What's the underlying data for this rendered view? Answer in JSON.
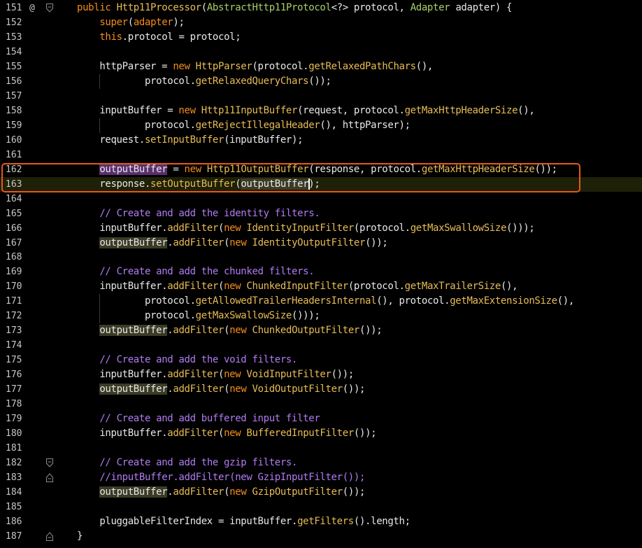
{
  "editor": {
    "colors": {
      "background": "#000000",
      "keyword": "#f48c1b",
      "method": "#e8bc55",
      "plain": "#e8e8e8",
      "comment": "#b07cf2",
      "type": "#a8cf6a",
      "selection_box": "#e8571b"
    },
    "lines": [
      {
        "n": "151",
        "gutter": "@",
        "fold": "fold-open",
        "tokens": [
          [
            "kw",
            "public "
          ],
          [
            "fn",
            "Http11Processor"
          ],
          [
            "pl",
            "("
          ],
          [
            "ty",
            "AbstractHttp11Protocol"
          ],
          [
            "pl",
            "<?> protocol, "
          ],
          [
            "ty",
            "Adapter"
          ],
          [
            "pl",
            " adapter) {"
          ]
        ]
      },
      {
        "n": "152",
        "tokens": [
          [
            "pl",
            "    "
          ],
          [
            "kw",
            "super"
          ],
          [
            "pl",
            "("
          ],
          [
            "kw",
            "adapter"
          ],
          [
            "pl",
            ");"
          ]
        ]
      },
      {
        "n": "153",
        "tokens": [
          [
            "pl",
            "    "
          ],
          [
            "kw",
            "this"
          ],
          [
            "pl",
            ".protocol = protocol;"
          ]
        ]
      },
      {
        "n": "154",
        "tokens": []
      },
      {
        "n": "155",
        "tokens": [
          [
            "pl",
            "    httpParser = "
          ],
          [
            "kw",
            "new "
          ],
          [
            "fn",
            "HttpParser"
          ],
          [
            "pl",
            "(protocol."
          ],
          [
            "fn",
            "getRelaxedPathChars"
          ],
          [
            "pl",
            "(),"
          ]
        ]
      },
      {
        "n": "156",
        "guide": true,
        "tokens": [
          [
            "pl",
            "            protocol."
          ],
          [
            "fn",
            "getRelaxedQueryChars"
          ],
          [
            "pl",
            "());"
          ]
        ]
      },
      {
        "n": "157",
        "tokens": []
      },
      {
        "n": "158",
        "tokens": [
          [
            "pl",
            "    inputBuffer = "
          ],
          [
            "kw",
            "new "
          ],
          [
            "fn",
            "Http11InputBuffer"
          ],
          [
            "pl",
            "(request, protocol."
          ],
          [
            "fn",
            "getMaxHttpHeaderSize"
          ],
          [
            "pl",
            "(),"
          ]
        ]
      },
      {
        "n": "159",
        "guide": true,
        "tokens": [
          [
            "pl",
            "            protocol."
          ],
          [
            "fn",
            "getRejectIllegalHeader"
          ],
          [
            "pl",
            "(), httpParser);"
          ]
        ]
      },
      {
        "n": "160",
        "tokens": [
          [
            "pl",
            "    request."
          ],
          [
            "fn",
            "setInputBuffer"
          ],
          [
            "pl",
            "(inputBuffer);"
          ]
        ]
      },
      {
        "n": "161",
        "tokens": []
      },
      {
        "n": "162",
        "tokens": [
          [
            "pl",
            "    "
          ],
          [
            "write",
            "outputBuffer"
          ],
          [
            "pl",
            " = "
          ],
          [
            "kw",
            "new "
          ],
          [
            "fn",
            "Http11OutputBuffer"
          ],
          [
            "pl",
            "(response, protocol."
          ],
          [
            "fn",
            "getMaxHttpHeaderSize"
          ],
          [
            "pl",
            "());"
          ]
        ]
      },
      {
        "n": "163",
        "cursorline": true,
        "tokens": [
          [
            "pl",
            "    response."
          ],
          [
            "fn",
            "setOutputBuffer"
          ],
          [
            "pl",
            "("
          ],
          [
            "readcaret",
            "outputBuffer"
          ],
          [
            "pl",
            ");"
          ]
        ]
      },
      {
        "n": "164",
        "tokens": []
      },
      {
        "n": "165",
        "tokens": [
          [
            "pl",
            "    "
          ],
          [
            "cm",
            "// Create and add the identity filters."
          ]
        ]
      },
      {
        "n": "166",
        "tokens": [
          [
            "pl",
            "    inputBuffer."
          ],
          [
            "fn",
            "addFilter"
          ],
          [
            "pl",
            "("
          ],
          [
            "kw",
            "new "
          ],
          [
            "fn",
            "IdentityInputFilter"
          ],
          [
            "pl",
            "(protocol."
          ],
          [
            "fn",
            "getMaxSwallowSize"
          ],
          [
            "pl",
            "()));"
          ]
        ]
      },
      {
        "n": "167",
        "tokens": [
          [
            "pl",
            "    "
          ],
          [
            "read",
            "outputBuffer"
          ],
          [
            "pl",
            "."
          ],
          [
            "fn",
            "addFilter"
          ],
          [
            "pl",
            "("
          ],
          [
            "kw",
            "new "
          ],
          [
            "fn",
            "IdentityOutputFilter"
          ],
          [
            "pl",
            "());"
          ]
        ]
      },
      {
        "n": "168",
        "tokens": []
      },
      {
        "n": "169",
        "tokens": [
          [
            "pl",
            "    "
          ],
          [
            "cm",
            "// Create and add the chunked filters."
          ]
        ]
      },
      {
        "n": "170",
        "tokens": [
          [
            "pl",
            "    inputBuffer."
          ],
          [
            "fn",
            "addFilter"
          ],
          [
            "pl",
            "("
          ],
          [
            "kw",
            "new "
          ],
          [
            "fn",
            "ChunkedInputFilter"
          ],
          [
            "pl",
            "(protocol."
          ],
          [
            "fn",
            "getMaxTrailerSize"
          ],
          [
            "pl",
            "(),"
          ]
        ]
      },
      {
        "n": "171",
        "guide": true,
        "tokens": [
          [
            "pl",
            "            protocol."
          ],
          [
            "fn",
            "getAllowedTrailerHeadersInternal"
          ],
          [
            "pl",
            "(), protocol."
          ],
          [
            "fn",
            "getMaxExtensionSize"
          ],
          [
            "pl",
            "(),"
          ]
        ]
      },
      {
        "n": "172",
        "guide": true,
        "tokens": [
          [
            "pl",
            "            protocol."
          ],
          [
            "fn",
            "getMaxSwallowSize"
          ],
          [
            "pl",
            "()));"
          ]
        ]
      },
      {
        "n": "173",
        "tokens": [
          [
            "pl",
            "    "
          ],
          [
            "read",
            "outputBuffer"
          ],
          [
            "pl",
            "."
          ],
          [
            "fn",
            "addFilter"
          ],
          [
            "pl",
            "("
          ],
          [
            "kw",
            "new "
          ],
          [
            "fn",
            "ChunkedOutputFilter"
          ],
          [
            "pl",
            "());"
          ]
        ]
      },
      {
        "n": "174",
        "tokens": []
      },
      {
        "n": "175",
        "tokens": [
          [
            "pl",
            "    "
          ],
          [
            "cm",
            "// Create and add the void filters."
          ]
        ]
      },
      {
        "n": "176",
        "tokens": [
          [
            "pl",
            "    inputBuffer."
          ],
          [
            "fn",
            "addFilter"
          ],
          [
            "pl",
            "("
          ],
          [
            "kw",
            "new "
          ],
          [
            "fn",
            "VoidInputFilter"
          ],
          [
            "pl",
            "());"
          ]
        ]
      },
      {
        "n": "177",
        "tokens": [
          [
            "pl",
            "    "
          ],
          [
            "read",
            "outputBuffer"
          ],
          [
            "pl",
            "."
          ],
          [
            "fn",
            "addFilter"
          ],
          [
            "pl",
            "("
          ],
          [
            "kw",
            "new "
          ],
          [
            "fn",
            "VoidOutputFilter"
          ],
          [
            "pl",
            "());"
          ]
        ]
      },
      {
        "n": "178",
        "tokens": []
      },
      {
        "n": "179",
        "tokens": [
          [
            "pl",
            "    "
          ],
          [
            "cm",
            "// Create and add buffered input filter"
          ]
        ]
      },
      {
        "n": "180",
        "tokens": [
          [
            "pl",
            "    inputBuffer."
          ],
          [
            "fn",
            "addFilter"
          ],
          [
            "pl",
            "("
          ],
          [
            "kw",
            "new "
          ],
          [
            "fn",
            "BufferedInputFilter"
          ],
          [
            "pl",
            "());"
          ]
        ]
      },
      {
        "n": "181",
        "tokens": []
      },
      {
        "n": "182",
        "fold": "fold-open",
        "tokens": [
          [
            "pl",
            "    "
          ],
          [
            "cm",
            "// Create and add the gzip filters."
          ]
        ]
      },
      {
        "n": "183",
        "fold": "fold-close",
        "tokens": [
          [
            "pl",
            "    "
          ],
          [
            "cm",
            "//inputBuffer.addFilter(new GzipInputFilter());"
          ]
        ]
      },
      {
        "n": "184",
        "tokens": [
          [
            "pl",
            "    "
          ],
          [
            "read",
            "outputBuffer"
          ],
          [
            "pl",
            "."
          ],
          [
            "fn",
            "addFilter"
          ],
          [
            "pl",
            "("
          ],
          [
            "kw",
            "new "
          ],
          [
            "fn",
            "GzipOutputFilter"
          ],
          [
            "pl",
            "());"
          ]
        ]
      },
      {
        "n": "185",
        "tokens": []
      },
      {
        "n": "186",
        "tokens": [
          [
            "pl",
            "    pluggableFilterIndex = inputBuffer."
          ],
          [
            "fn",
            "getFilters"
          ],
          [
            "pl",
            "().length;"
          ]
        ]
      },
      {
        "n": "187",
        "fold": "fold-close",
        "tokens": [
          [
            "pl",
            "}"
          ]
        ]
      }
    ]
  }
}
